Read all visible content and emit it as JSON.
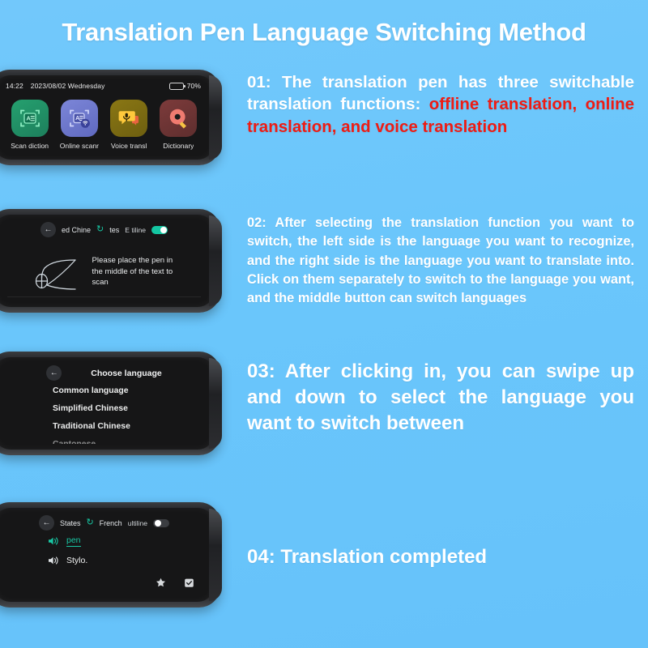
{
  "page": {
    "title": "Translation Pen Language Switching Method",
    "background_color": "#6ac6fa",
    "text_color": "#ffffff",
    "highlight_color": "#ee1c14"
  },
  "screen1": {
    "status": {
      "time": "14:22",
      "date": "2023/08/02 Wednesday",
      "battery_percent": "70%"
    },
    "apps": [
      {
        "label": "Scan diction",
        "icon": "scan-dictionary-icon",
        "color": "#25a06f"
      },
      {
        "label": "Online scanr",
        "icon": "online-scan-wifi-icon",
        "color": "#7c86d8"
      },
      {
        "label": "Voice transl",
        "icon": "voice-translation-icon",
        "color": "#8a7714"
      },
      {
        "label": "Dictionary",
        "icon": "dictionary-search-icon",
        "color": "#7d3b3b"
      }
    ]
  },
  "screen2": {
    "back_icon": "back-arrow-icon",
    "source_lang": "ed Chine",
    "swap_icon": "swap-languages-icon",
    "target_lang": "tes",
    "multiline_label": "E  tiline",
    "multiline_toggle": "on",
    "pen_icon": "scanning-pen-illustration",
    "hint": "Please place the pen in the middle of the text to scan"
  },
  "screen3": {
    "back_icon": "back-arrow-icon",
    "title": "Choose language",
    "items": [
      "Common language",
      "Simplified Chinese",
      "Traditional Chinese",
      "Cantonese"
    ]
  },
  "screen4": {
    "back_icon": "back-arrow-icon",
    "source_lang": "States",
    "swap_icon": "swap-languages-icon",
    "target_lang": "French",
    "multiline_label": "ultiline",
    "multiline_toggle": "off",
    "source_word": "pen",
    "target_word": "Stylo.",
    "speaker_icon": "speaker-icon",
    "favorite_icon": "star-icon",
    "copy_icon": "clipboard-check-icon"
  },
  "steps": {
    "p1_a": "01: The translation pen has three switchable translation functions: ",
    "p1_b": "offline translation, online translation, and voice translation",
    "p2": "02: After selecting the translation function you want to switch, the left side is the language you want to recognize, and the right side is the language you want to translate into. Click on them separately to switch to the language you want, and the middle button can switch languages",
    "p3": "03: After clicking in, you can swipe up and down to select the language you want to switch between",
    "p4": "04:  Translation completed"
  }
}
